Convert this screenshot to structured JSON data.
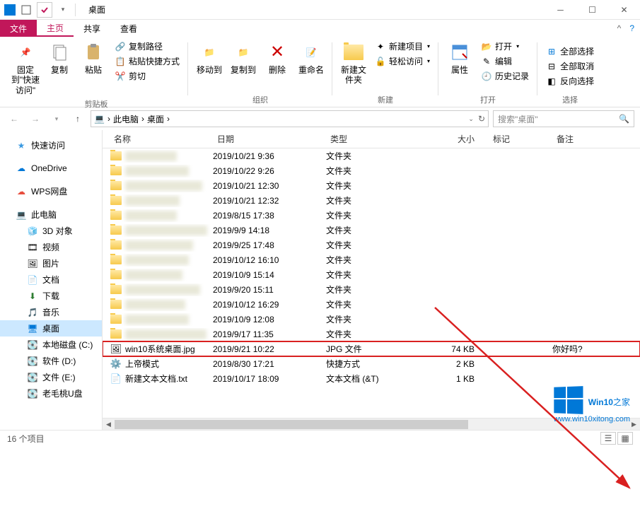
{
  "title": "桌面",
  "tabs": {
    "file": "文件",
    "home": "主页",
    "share": "共享",
    "view": "查看"
  },
  "ribbon": {
    "pin": "固定到\"快速访问\"",
    "copy": "复制",
    "paste": "粘贴",
    "copy_path": "复制路径",
    "paste_shortcut": "粘贴快捷方式",
    "cut": "剪切",
    "clipboard_group": "剪贴板",
    "move_to": "移动到",
    "copy_to": "复制到",
    "delete": "删除",
    "rename": "重命名",
    "organize_group": "组织",
    "new_folder": "新建文件夹",
    "new_item": "新建项目",
    "easy_access": "轻松访问",
    "new_group": "新建",
    "properties": "属性",
    "open": "打开",
    "edit": "编辑",
    "history": "历史记录",
    "open_group": "打开",
    "select_all": "全部选择",
    "select_none": "全部取消",
    "invert": "反向选择",
    "select_group": "选择"
  },
  "breadcrumb": [
    "此电脑",
    "桌面"
  ],
  "search_placeholder": "搜索\"桌面\"",
  "nav": {
    "quick_access": "快速访问",
    "onedrive": "OneDrive",
    "wps": "WPS网盘",
    "this_pc": "此电脑",
    "objects3d": "3D 对象",
    "videos": "视频",
    "pictures": "图片",
    "documents": "文档",
    "downloads": "下载",
    "music": "音乐",
    "desktop": "桌面",
    "disk_c": "本地磁盘 (C:)",
    "disk_d": "软件 (D:)",
    "disk_e": "文件 (E:)",
    "disk_u": "老毛桃U盘"
  },
  "columns": {
    "name": "名称",
    "date": "日期",
    "type": "类型",
    "size": "大小",
    "tag": "标记",
    "note": "备注"
  },
  "files": [
    {
      "date": "2019/10/21 9:36",
      "type": "文件夹",
      "size": "",
      "kind": "folder"
    },
    {
      "date": "2019/10/22 9:26",
      "type": "文件夹",
      "size": "",
      "kind": "folder"
    },
    {
      "date": "2019/10/21 12:30",
      "type": "文件夹",
      "size": "",
      "kind": "folder"
    },
    {
      "date": "2019/10/21 12:32",
      "type": "文件夹",
      "size": "",
      "kind": "folder"
    },
    {
      "date": "2019/8/15 17:38",
      "type": "文件夹",
      "size": "",
      "kind": "folder"
    },
    {
      "date": "2019/9/9 14:18",
      "type": "文件夹",
      "size": "",
      "kind": "folder"
    },
    {
      "date": "2019/9/25 17:48",
      "type": "文件夹",
      "size": "",
      "kind": "folder"
    },
    {
      "date": "2019/10/12 16:10",
      "type": "文件夹",
      "size": "",
      "kind": "folder"
    },
    {
      "date": "2019/10/9 15:14",
      "type": "文件夹",
      "size": "",
      "kind": "folder"
    },
    {
      "date": "2019/9/20 15:11",
      "type": "文件夹",
      "size": "",
      "kind": "folder"
    },
    {
      "date": "2019/10/12 16:29",
      "type": "文件夹",
      "size": "",
      "kind": "folder"
    },
    {
      "date": "2019/10/9 12:08",
      "type": "文件夹",
      "size": "",
      "kind": "folder"
    },
    {
      "date": "2019/9/17 11:35",
      "type": "文件夹",
      "size": "",
      "kind": "folder"
    },
    {
      "name": "win10系统桌面.jpg",
      "date": "2019/9/21 10:22",
      "type": "JPG 文件",
      "size": "74 KB",
      "note": "你好吗?",
      "kind": "jpg",
      "highlighted": true
    },
    {
      "name": "上帝模式",
      "date": "2019/8/30 17:21",
      "type": "快捷方式",
      "size": "2 KB",
      "kind": "shortcut"
    },
    {
      "name": "新建文本文档.txt",
      "date": "2019/10/17 18:09",
      "type": "文本文档 (&T)",
      "size": "1 KB",
      "kind": "txt"
    }
  ],
  "status": "16 个项目",
  "watermark": {
    "brand_a": "Win10",
    "brand_b": "之家",
    "url": "www.win10xitong.com"
  }
}
